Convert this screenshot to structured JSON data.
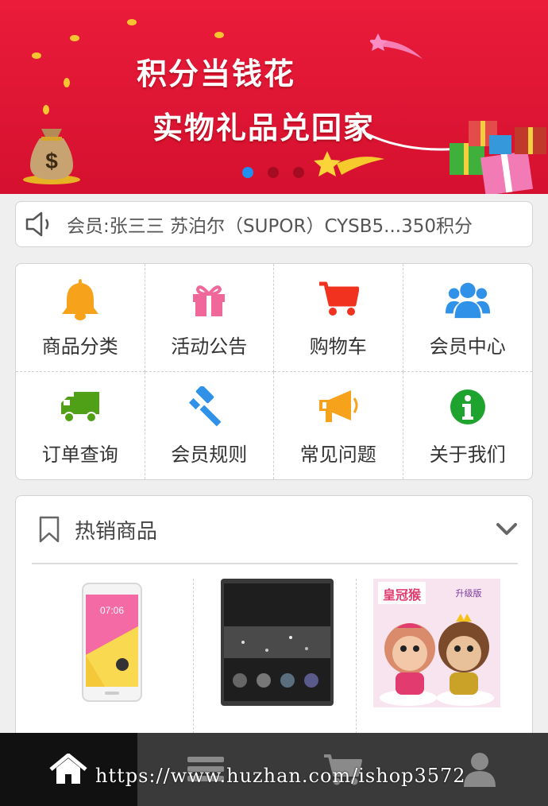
{
  "banner": {
    "line1": "积分当钱花",
    "line2": "实物礼品兑回家",
    "slides": [
      {
        "active": true
      },
      {
        "active": false
      },
      {
        "active": false
      }
    ]
  },
  "notice": {
    "icon": "speaker-icon",
    "text": "会员:张三三 苏泊尔（SUPOR）CYSB5...350积分"
  },
  "menu": [
    {
      "label": "商品分类",
      "icon": "bell-icon",
      "color": "#f7a21b"
    },
    {
      "label": "活动公告",
      "icon": "gift-icon",
      "color": "#f0689a"
    },
    {
      "label": "购物车",
      "icon": "cart-icon",
      "color": "#f0321e"
    },
    {
      "label": "会员中心",
      "icon": "users-icon",
      "color": "#2f92e8"
    },
    {
      "label": "订单查询",
      "icon": "truck-icon",
      "color": "#4fa016"
    },
    {
      "label": "会员规则",
      "icon": "gavel-icon",
      "color": "#2f92e8"
    },
    {
      "label": "常见问题",
      "icon": "megaphone-icon",
      "color": "#f7a21b"
    },
    {
      "label": "关于我们",
      "icon": "info-icon",
      "color": "#1ea32e"
    }
  ],
  "hot": {
    "title": "热销商品",
    "products": [
      {
        "name": "phone-white"
      },
      {
        "name": "phone-black"
      },
      {
        "name": "monkey-toys"
      }
    ],
    "product_label_3_top": "皇冠猴",
    "product_label_3_badge": "升级版"
  },
  "bottom_nav": [
    {
      "icon": "home-icon",
      "active": true
    },
    {
      "icon": "list-icon",
      "active": false
    },
    {
      "icon": "cart-icon",
      "active": false
    },
    {
      "icon": "user-icon",
      "active": false
    }
  ],
  "watermark": "https://www.huzhan.com/ishop3572"
}
